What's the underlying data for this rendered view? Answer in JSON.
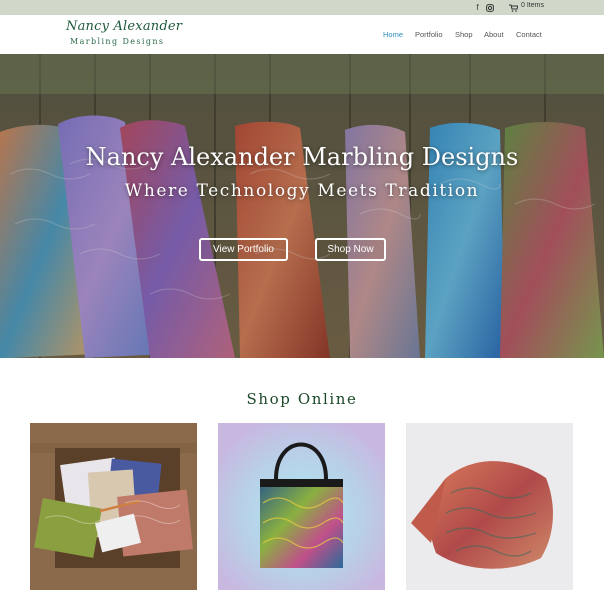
{
  "topbar": {
    "icons": [
      "facebook-icon",
      "instagram-icon",
      "cart-icon"
    ],
    "cart_text": "0 Items"
  },
  "header": {
    "logo_script": "Nancy Alexander",
    "logo_sub": "Marbling Designs",
    "nav": [
      {
        "label": "Home",
        "active": true
      },
      {
        "label": "Portfolio",
        "active": false
      },
      {
        "label": "Shop",
        "active": false
      },
      {
        "label": "About",
        "active": false
      },
      {
        "label": "Contact",
        "active": false
      }
    ]
  },
  "hero": {
    "title": "Nancy Alexander Marbling Designs",
    "subtitle": "Where Technology Meets Tradition",
    "buttons": [
      "View Portfolio",
      "Shop Now"
    ]
  },
  "shop": {
    "title": "Shop Online",
    "products": [
      "marbled-paper-cards",
      "marbled-tote-bag",
      "marbled-silk-scarf"
    ]
  },
  "colors": {
    "accent": "#2a8fbd",
    "heading_green": "#1d4a2a",
    "topbar_bg": "#cfd8c9"
  }
}
